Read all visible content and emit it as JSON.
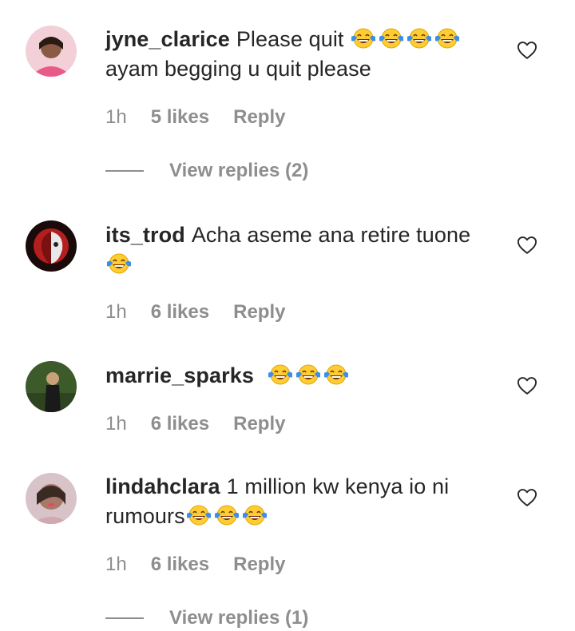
{
  "comments": [
    {
      "username": "jyne_clarice",
      "text": "Please quit",
      "emoji_after_text": 4,
      "text2": "ayam begging u quit please",
      "time": "1h",
      "likes": "5 likes",
      "reply": "Reply",
      "view_replies": "View replies (2)",
      "avatar_icon": "avatar-photo"
    },
    {
      "username": "its_trod",
      "text": "Acha aseme ana retire tuone",
      "emoji_after_text": 1,
      "time": "1h",
      "likes": "6 likes",
      "reply": "Reply",
      "avatar_icon": "avatar-photo"
    },
    {
      "username": "marrie_sparks",
      "text": "",
      "emoji_after_text": 3,
      "time": "1h",
      "likes": "6 likes",
      "reply": "Reply",
      "avatar_icon": "avatar-photo"
    },
    {
      "username": "lindahclara",
      "text": "1 million kw kenya io ni",
      "text2": "rumours",
      "emoji_after_text": 3,
      "time": "1h",
      "likes": "6 likes",
      "reply": "Reply",
      "view_replies": "View replies (1)",
      "avatar_icon": "avatar-photo"
    }
  ],
  "icons": {
    "like": "heart-outline-icon",
    "emoji": "face-with-tears-of-joy-emoji"
  },
  "colors": {
    "text": "#262626",
    "muted": "#8e8e8e",
    "emoji_face": "#ffcc33",
    "emoji_tear": "#3b8eea"
  }
}
